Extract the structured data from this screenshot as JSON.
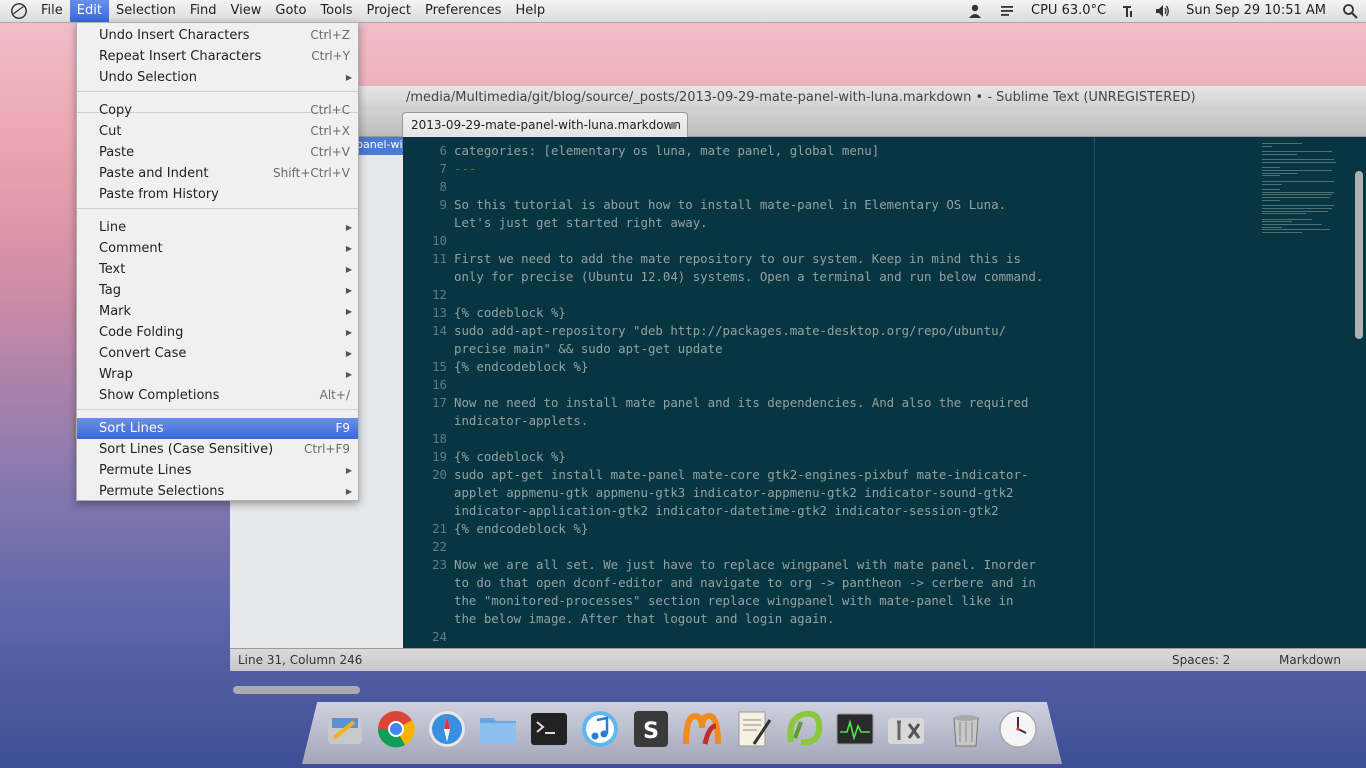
{
  "top_panel": {
    "menus": [
      "File",
      "Edit",
      "Selection",
      "Find",
      "View",
      "Goto",
      "Tools",
      "Project",
      "Preferences",
      "Help"
    ],
    "active_menu": "Edit",
    "cpu": "CPU 63.0°C",
    "datetime": "Sun Sep 29 10:51 AM"
  },
  "window": {
    "title": "/media/Multimedia/git/blog/source/_posts/2013-09-29-mate-panel-with-luna.markdown • - Sublime Text (UNREGISTERED)",
    "tab_label": "2013-09-29-mate-panel-with-luna.markdown",
    "sidebar_selected": "panel-wi"
  },
  "edit_menu": {
    "items": [
      {
        "label": "Undo Insert Characters",
        "shortcut": "Ctrl+Z"
      },
      {
        "label": "Repeat Insert Characters",
        "shortcut": "Ctrl+Y"
      },
      {
        "label": "Undo Selection",
        "submenu": true
      },
      {
        "label": "Copy",
        "shortcut": "Ctrl+C"
      },
      {
        "label": "Cut",
        "shortcut": "Ctrl+X"
      },
      {
        "label": "Paste",
        "shortcut": "Ctrl+V"
      },
      {
        "label": "Paste and Indent",
        "shortcut": "Shift+Ctrl+V"
      },
      {
        "label": "Paste from History"
      },
      {
        "label": "Line",
        "submenu": true
      },
      {
        "label": "Comment",
        "submenu": true
      },
      {
        "label": "Text",
        "submenu": true
      },
      {
        "label": "Tag",
        "submenu": true
      },
      {
        "label": "Mark",
        "submenu": true
      },
      {
        "label": "Code Folding",
        "submenu": true
      },
      {
        "label": "Convert Case",
        "submenu": true
      },
      {
        "label": "Wrap",
        "submenu": true
      },
      {
        "label": "Show Completions",
        "shortcut": "Alt+/"
      },
      {
        "label": "Sort Lines",
        "shortcut": "F9",
        "highlighted": true
      },
      {
        "label": "Sort Lines (Case Sensitive)",
        "shortcut": "Ctrl+F9"
      },
      {
        "label": "Permute Lines",
        "submenu": true
      },
      {
        "label": "Permute Selections",
        "submenu": true
      }
    ]
  },
  "editor": {
    "line_numbers": [
      "6",
      "7",
      "8",
      "9",
      "10",
      "11",
      "12",
      "13",
      "14",
      "15",
      "16",
      "17",
      "18",
      "19",
      "20",
      "21",
      "22",
      "23",
      "24"
    ],
    "lines": [
      {
        "text": "categories: [elementary os luna, mate panel, global menu]"
      },
      {
        "text": "---",
        "style": "dash"
      },
      {
        "text": ""
      },
      {
        "text": "So this tutorial is about how to install mate-panel in Elementary OS Luna."
      },
      {
        "text": "Let's just get started right away."
      },
      {
        "text": ""
      },
      {
        "text": "First we need to add the mate repository to our system. Keep in mind this is"
      },
      {
        "text": "only for precise (Ubuntu 12.04) systems. Open a terminal and run below command."
      },
      {
        "text": ""
      },
      {
        "text": "{% codeblock %}"
      },
      {
        "text": "sudo add-apt-repository \"deb http://packages.mate-desktop.org/repo/ubuntu/"
      },
      {
        "text": "precise main\" && sudo apt-get update"
      },
      {
        "text": "{% endcodeblock %}"
      },
      {
        "text": ""
      },
      {
        "text": "Now ne need to install mate panel and its dependencies. And also the required"
      },
      {
        "text": "indicator-applets."
      },
      {
        "text": ""
      },
      {
        "text": "{% codeblock %}"
      },
      {
        "text": "sudo apt-get install mate-panel mate-core gtk2-engines-pixbuf mate-indicator-"
      },
      {
        "text": "applet appmenu-gtk appmenu-gtk3 indicator-appmenu-gtk2 indicator-sound-gtk2"
      },
      {
        "text": "indicator-application-gtk2 indicator-datetime-gtk2 indicator-session-gtk2"
      },
      {
        "text": "{% endcodeblock %}"
      },
      {
        "text": ""
      },
      {
        "text": "Now we are all set. We just have to replace wingpanel with mate panel. Inorder"
      },
      {
        "text": "to do that open dconf-editor and navigate to org -> pantheon -> cerbere and in"
      },
      {
        "text": "the \"monitored-processes\" section replace wingpanel with mate-panel like in"
      },
      {
        "text": "the below image. After that logout and login again."
      },
      {
        "text": ""
      }
    ]
  },
  "status_bar": {
    "position": "Line 31, Column 246",
    "indent": "Spaces: 2",
    "syntax": "Markdown"
  },
  "dock": {
    "icons": [
      "settings-icon",
      "chrome-icon",
      "safari-icon",
      "folder-icon",
      "terminal-icon",
      "itunes-icon",
      "sublime-icon",
      "mendeley-icon",
      "text-editor-icon",
      "phpstorm-icon",
      "system-monitor-icon",
      "tools-icon",
      "trash-icon",
      "clock-icon"
    ]
  }
}
